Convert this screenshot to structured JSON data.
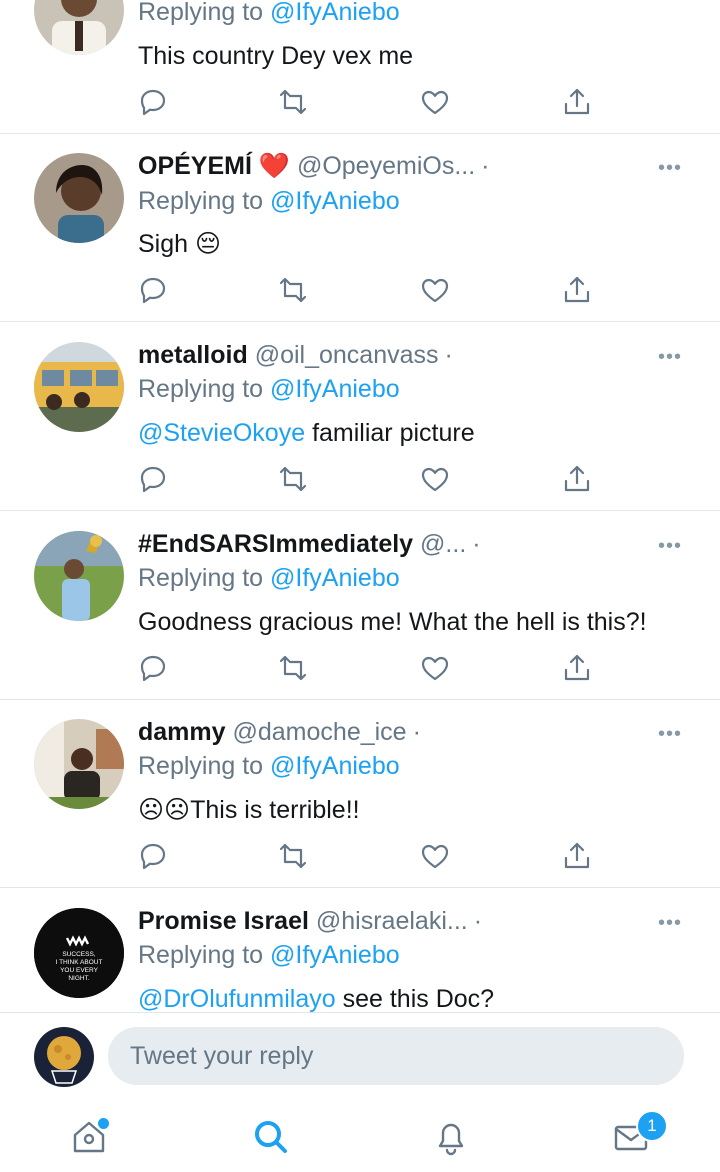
{
  "colors": {
    "accent": "#1da1f2",
    "secondary_text": "#657786",
    "divider": "#e1e8ed"
  },
  "tweets": [
    {
      "name": "",
      "handle": "",
      "replying_label": "Replying to",
      "replying_to": "@IfyAniebo",
      "mention": "",
      "text": "This country Dey vex me",
      "avatar": "man-avatar"
    },
    {
      "name": "OPÉYEMÍ ❤️",
      "handle": "@OpeyemiOs...",
      "replying_label": "Replying to",
      "replying_to": "@IfyAniebo",
      "mention": "",
      "text": "Sigh 😔",
      "avatar": "girl-avatar"
    },
    {
      "name": "metalloid",
      "handle": "@oil_oncanvass",
      "replying_label": "Replying to",
      "replying_to": "@IfyAniebo",
      "mention": "@StevieOkoye",
      "text": " familiar picture",
      "avatar": "bus-avatar"
    },
    {
      "name": "#EndSARSImmediately",
      "handle": "@...",
      "replying_label": "Replying to",
      "replying_to": "@IfyAniebo",
      "mention": "",
      "text": "Goodness gracious me! What the hell is this?!",
      "avatar": "trophy-avatar"
    },
    {
      "name": "dammy",
      "handle": "@damoche_ice",
      "replying_label": "Replying to",
      "replying_to": "@IfyAniebo",
      "mention": "",
      "text": "☹☹This is terrible!!",
      "avatar": "man-sitting-avatar"
    },
    {
      "name": "Promise Israel",
      "handle": "@hisraelaki...",
      "replying_label": "Replying to",
      "replying_to": "@IfyAniebo",
      "mention": "@DrOlufunmilayo",
      "text": " see this Doc?",
      "avatar": "quote-avatar",
      "avatar_text": [
        "SUCCESS,",
        "I THINK ABOUT",
        "YOU EVERY",
        "NIGHT."
      ]
    }
  ],
  "more_label": "•••",
  "dot_sep": "·",
  "composer": {
    "placeholder": "Tweet your reply",
    "avatar": "moon-avatar"
  },
  "tabbar": {
    "icons": [
      "home-icon",
      "search-icon",
      "notifications-icon",
      "messages-icon"
    ],
    "messages_badge": "1"
  }
}
